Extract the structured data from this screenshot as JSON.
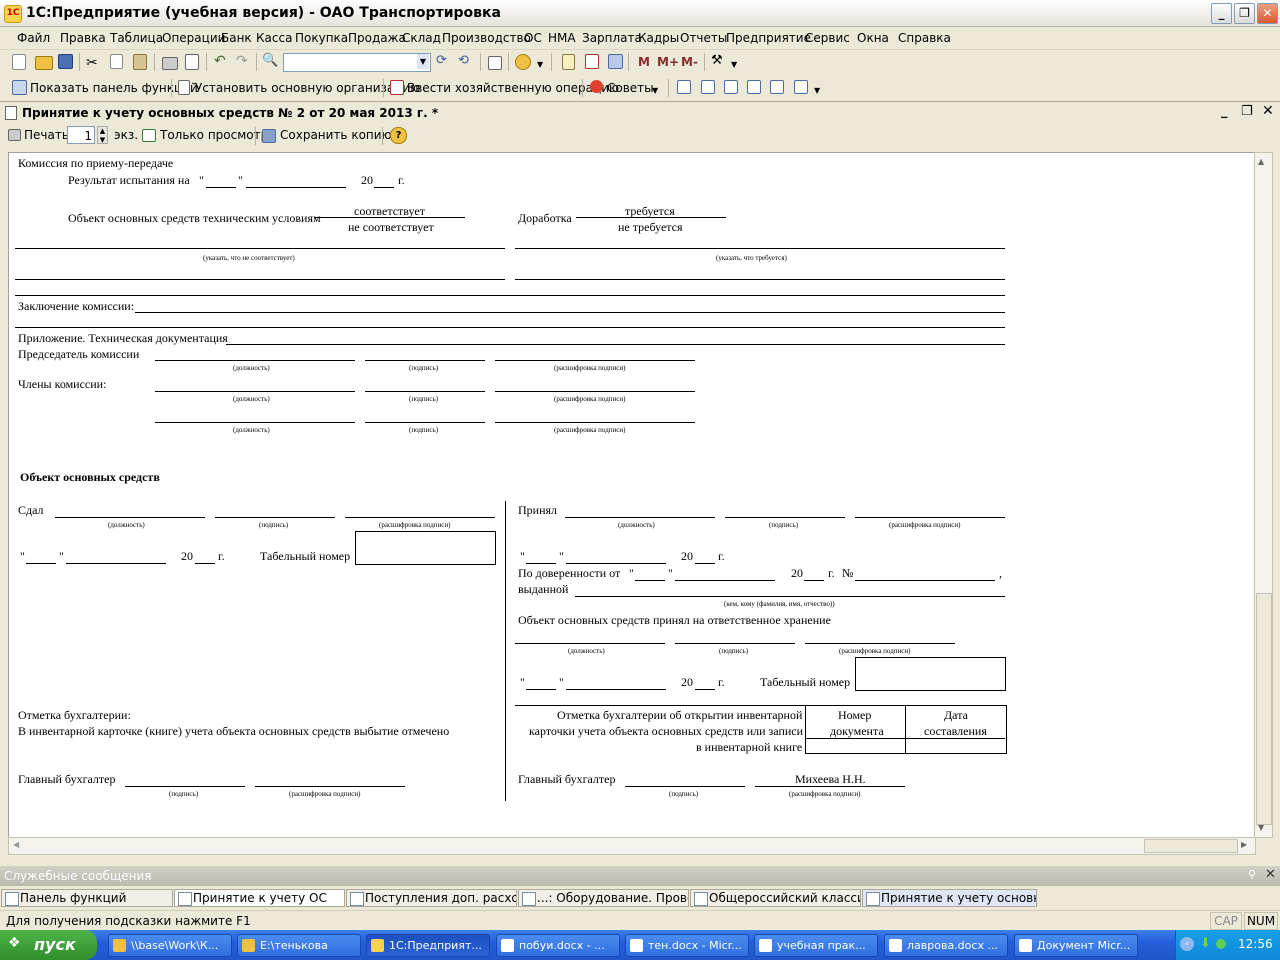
{
  "window": {
    "title": "1С:Предприятие (учебная версия) - ОАО Транспортировка",
    "logo": "1C"
  },
  "menu": [
    "Файл",
    "Правка",
    "Таблица",
    "Операции",
    "Банк",
    "Касса",
    "Покупка",
    "Продажа",
    "Склад",
    "Производство",
    "ОС",
    "НМА",
    "Зарплата",
    "Кадры",
    "Отчеты",
    "Предприятие",
    "Сервис",
    "Окна",
    "Справка"
  ],
  "toolbar2": {
    "show_panel": "Показать панель функций",
    "set_org": "Установить основную организацию",
    "enter_op": "Ввести хозяйственную операцию",
    "tips": "Советы"
  },
  "toolbar1": {
    "m": "M",
    "mplus": "M+",
    "mminus": "M-"
  },
  "doc": {
    "title": "Принятие к учету основных средств № 2 от 20 мая 2013 г. *",
    "print": "Печать",
    "copies": "1",
    "copies_unit": "экз.",
    "view_only": "Только просмотр",
    "save_copy": "Сохранить копию..."
  },
  "form": {
    "commission": "Комиссия по приему-передаче",
    "test_result": "Результат испытания на",
    "q1": "\"",
    "q2": "\"",
    "yr": "20",
    "g": "г.",
    "object_tech": "Объект основных средств техническим условиям",
    "complies": "соответствует",
    "not_complies": "не соответствует",
    "rework": "Доработка",
    "required": "требуется",
    "not_required": "не требуется",
    "hint_notcomply": "(указать, что не соответствует)",
    "hint_required": "(указать, что требуется)",
    "conclusion": "Заключение комиссии:",
    "appendix": "Приложение. Техническая документация",
    "chairman": "Председатель комиссии",
    "members": "Члены комиссии:",
    "position": "(должность)",
    "signature": "(подпись)",
    "decoding": "(расшифровка подписи)",
    "object_title": "Объект основных средств",
    "handed": "Сдал",
    "accepted": "Принял",
    "tab_number": "Табельный номер",
    "by_proxy": "По доверенности от",
    "no": "№",
    "comma": ",",
    "issued": "выданной",
    "issued_hint": "(кем, кому (фамилия, имя, отчество))",
    "custody": "Объект основных средств принял на ответственное хранение",
    "acc_mark": "Отметка бухгалтерии:",
    "acc_mark2": "В инвентарной карточке (книге) учета объекта основных средств выбытие отмечено",
    "acc_open1": "Отметка бухгалтерии об открытии инвентарной",
    "acc_open2": "карточки учета объекта основных средств или записи",
    "acc_open3": "в инвентарной книге",
    "doc_number1": "Номер",
    "doc_number2": "документа",
    "date1": "Дата",
    "date2": "составления",
    "chief_acc": "Главный бухгалтер",
    "chief_name": "Михеева Н.Н."
  },
  "messages": {
    "title": "Служебные сообщения"
  },
  "window_tabs": [
    "Панель функций",
    "Принятие к учету ОС",
    "Поступления доп. расходов",
    "...: Оборудование. Проведен",
    "Общероссийский классиф...",
    "Принятие к учету основных..."
  ],
  "status": {
    "hint": "Для получения подсказки нажмите F1",
    "cap": "CAP",
    "num": "NUM"
  },
  "taskbar": {
    "start": "пуск",
    "tasks": [
      "\\\\base\\Work\\К...",
      "E:\\тенькова",
      "1С:Предприят...",
      "побуи.docx - ...",
      "тен.docx - Micr...",
      "учебная прак...",
      "лаврова.docx ...",
      "Документ Micr..."
    ],
    "clock": "12:56"
  },
  "colors": {
    "accent": "#245edb",
    "start": "#3a9e35",
    "chrome": "#ece9d8"
  }
}
